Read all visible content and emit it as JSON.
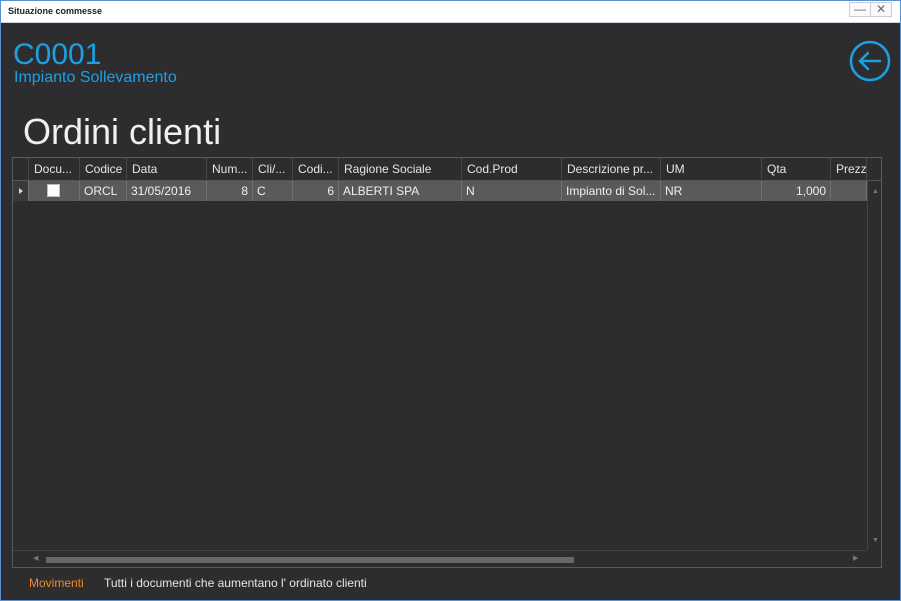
{
  "window": {
    "title": "Situazione commesse",
    "minimize_label": "—",
    "close_label": "✕"
  },
  "header": {
    "code": "C0001",
    "subtitle": "Impianto Sollevamento",
    "back_icon": "arrow-left-circle-icon",
    "accent": "#1ba1e2"
  },
  "section": {
    "title": "Ordini clienti"
  },
  "table": {
    "columns": [
      "Docu...",
      "Codice",
      "Data",
      "Num...",
      "Cli/...",
      "Codi...",
      "Ragione Sociale",
      "Cod.Prod",
      "Descrizione pr...",
      "UM",
      "Qta",
      "Prezzo"
    ],
    "rows": [
      {
        "documento": "",
        "codice": "ORCL",
        "data": "31/05/2016",
        "numero": "8",
        "cli": "C",
        "codice_cliente": "6",
        "ragione_sociale": "ALBERTI SPA",
        "cod_prod": "N",
        "descrizione": "Impianto di Sol...",
        "um": "NR",
        "qta": "1,000",
        "prezzo": ""
      }
    ]
  },
  "footer": {
    "link_label": "Movimenti",
    "link_color": "#f0892a",
    "description": "Tutti i documenti che aumentano l' ordinato clienti"
  }
}
